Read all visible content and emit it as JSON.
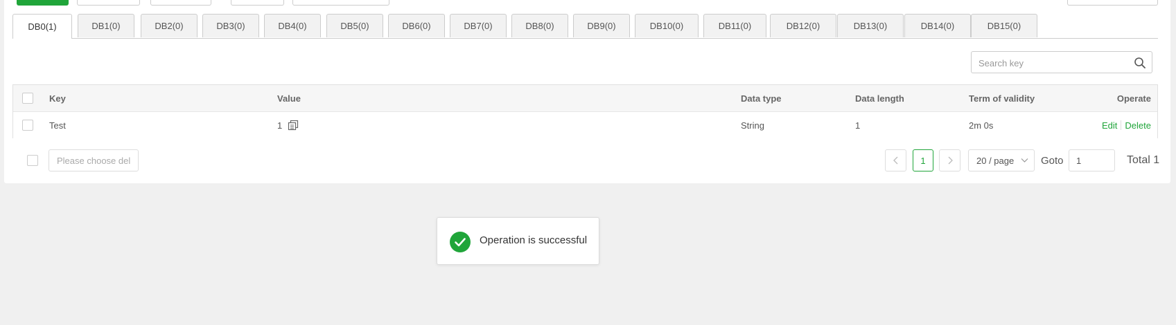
{
  "tabs": [
    {
      "label": "DB0(1)",
      "active": true
    },
    {
      "label": "DB1(0)"
    },
    {
      "label": "DB2(0)"
    },
    {
      "label": "DB3(0)"
    },
    {
      "label": "DB4(0)"
    },
    {
      "label": "DB5(0)"
    },
    {
      "label": "DB6(0)"
    },
    {
      "label": "DB7(0)"
    },
    {
      "label": "DB8(0)"
    },
    {
      "label": "DB9(0)"
    },
    {
      "label": "DB10(0)"
    },
    {
      "label": "DB11(0)"
    },
    {
      "label": "DB12(0)"
    },
    {
      "label": "DB13(0)"
    },
    {
      "label": "DB14(0)"
    },
    {
      "label": "DB15(0)"
    }
  ],
  "search": {
    "placeholder": "Search key",
    "icon": "search-icon"
  },
  "table": {
    "headers": {
      "key": "Key",
      "value": "Value",
      "type": "Data type",
      "length": "Data length",
      "ttl": "Term of validity",
      "operate": "Operate"
    },
    "rows": [
      {
        "key": "Test",
        "value": "1",
        "type": "String",
        "length": "1",
        "ttl": "2m 0s",
        "edit": "Edit",
        "delete": "Delete"
      }
    ]
  },
  "footer": {
    "delete_select_placeholder": "Please choose del",
    "prev_icon": "chevron-left-icon",
    "current_page": "1",
    "next_icon": "chevron-right-icon",
    "page_size": "20 / page",
    "goto_label": "Goto",
    "goto_value": "1",
    "total": "Total 1"
  },
  "toast": {
    "message": "Operation is successful",
    "icon": "check-circle-icon"
  },
  "colors": {
    "accent": "#20a53a",
    "border": "#cccccc",
    "background": "#f0f0f0"
  }
}
